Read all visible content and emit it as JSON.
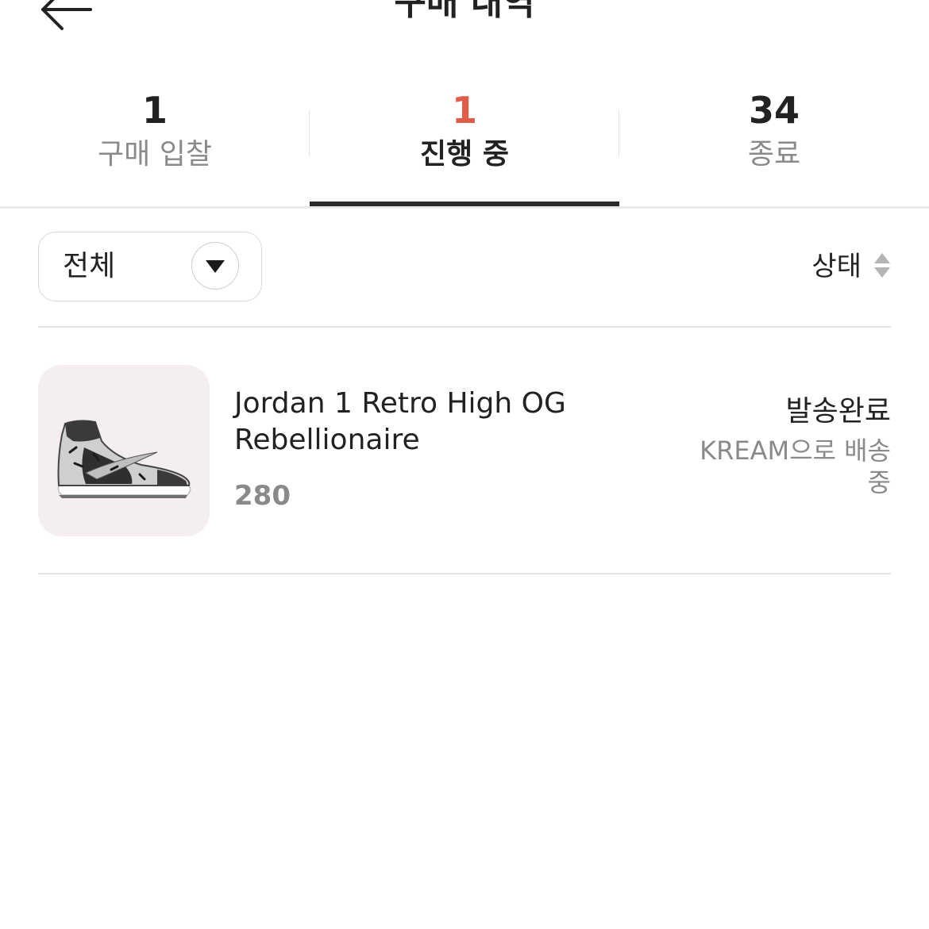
{
  "header": {
    "title": "구매 내역",
    "back_icon": "arrow-left-icon"
  },
  "tabs": [
    {
      "count": "1",
      "label": "구매 입찰",
      "active": false
    },
    {
      "count": "1",
      "label": "진행 중",
      "active": true
    },
    {
      "count": "34",
      "label": "종료",
      "active": false
    }
  ],
  "colors": {
    "accent": "#e05d4a",
    "active_underline": "#2b2b2b",
    "muted_text": "#8a8a8a",
    "thumb_bg": "#f4efee"
  },
  "filter": {
    "selected": "전체",
    "caret_icon": "chevron-down-icon"
  },
  "sort": {
    "label": "상태",
    "icon": "sort-icon"
  },
  "items": [
    {
      "name": "Jordan 1 Retro High OG Rebellionaire",
      "size": "280",
      "status": "발송완료",
      "status_detail": "KREAM으로 배송 중",
      "image_icon": "sneaker-icon"
    }
  ]
}
